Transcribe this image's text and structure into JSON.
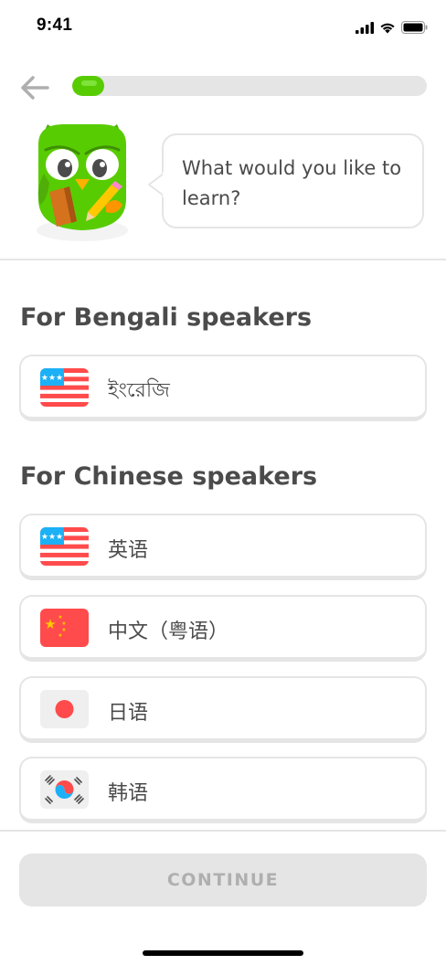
{
  "status_bar": {
    "time": "9:41",
    "icons": [
      "cellular-signal-icon",
      "wifi-icon",
      "battery-icon"
    ]
  },
  "header": {
    "back_icon": "arrow-left-icon",
    "progress_fraction": 0.09
  },
  "prompt": {
    "question": "What would you like to learn?"
  },
  "sections": [
    {
      "title": "For Bengali speakers",
      "options": [
        {
          "label": "ইংরেজি",
          "flag": "us-flag-icon"
        }
      ]
    },
    {
      "title": "For Chinese speakers",
      "options": [
        {
          "label": "英语",
          "flag": "us-flag-icon"
        },
        {
          "label": "中文（粤语）",
          "flag": "china-flag-icon"
        },
        {
          "label": "日语",
          "flag": "japan-flag-icon"
        },
        {
          "label": "韩语",
          "flag": "korea-flag-icon"
        }
      ]
    }
  ],
  "footer": {
    "continue_label": "CONTINUE"
  },
  "colors": {
    "brand_green": "#58cc02",
    "border_gray": "#e5e5e5",
    "text_gray": "#4b4b4b",
    "disabled_text": "#afafaf"
  }
}
